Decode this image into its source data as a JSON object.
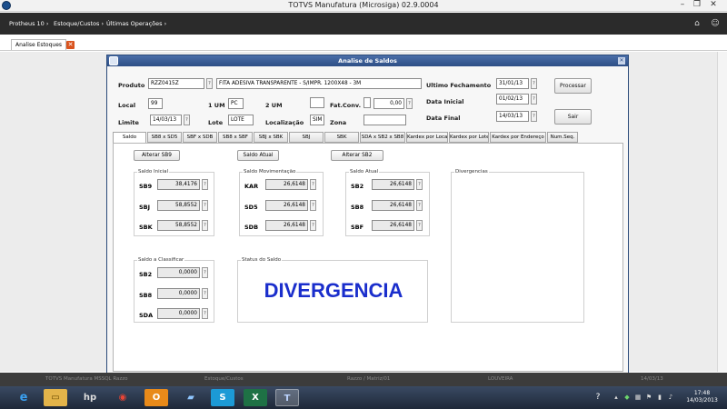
{
  "window": {
    "title": "TOTVS Manufatura (Microsiga) 02.9.0004"
  },
  "menubar": {
    "items": [
      "Protheus 10 ›",
      "Estoque/Custos ›",
      "Últimas Operações ›"
    ]
  },
  "doc_tab": {
    "label": "Analise Estoques"
  },
  "dialog": {
    "title": "Analise de Saldos",
    "produto": {
      "label": "Produto",
      "code": "RZZ0415Z",
      "description": "FITA ADESIVA TRANSPARENTE - S/IMPR. 1200X48 - 3M"
    },
    "local": {
      "label": "Local",
      "value": "99"
    },
    "um1": {
      "label": "1 UM",
      "value": "PC"
    },
    "um2": {
      "label": "2 UM",
      "value": ""
    },
    "fatconv": {
      "label": "Fat.Conv.",
      "flag": "",
      "value": "0,00"
    },
    "limite": {
      "label": "Limite",
      "value": "14/03/13"
    },
    "lote": {
      "label": "Lote",
      "value": "LOTE"
    },
    "localizacao": {
      "label": "Localização",
      "value": "SIM"
    },
    "zona": {
      "label": "Zona",
      "value": ""
    },
    "ultimo_fechamento": {
      "label": "Ultimo Fechamento",
      "value": "31/01/13"
    },
    "data_inicial": {
      "label": "Data Inicial",
      "value": "01/02/13"
    },
    "data_final": {
      "label": "Data Final",
      "value": "14/03/13"
    },
    "processar_label": "Processar",
    "sair_label": "Sair",
    "lookup_glyph": "?",
    "tabs": [
      "Saldo",
      "SB8 x SD5",
      "SBF x SDB",
      "SB8 x SBF",
      "SBJ x SBK",
      "SBJ",
      "SBK",
      "SDA x SB2 x SB8",
      "Kardex por Local",
      "Kardex por Lote",
      "Kardex por Endereço",
      "Num.Seq."
    ],
    "alterar_sb9_label": "Alterar SB9",
    "saldo_atual_label": "Saldo Atual",
    "alterar_sb2_label": "Alterar SB2",
    "saldo_inicial": {
      "title": "Saldo Inicial",
      "rows": [
        {
          "label": "SB9",
          "value": "38,4176"
        },
        {
          "label": "SBJ",
          "value": "58,8552"
        },
        {
          "label": "SBK",
          "value": "58,8552"
        }
      ]
    },
    "saldo_movimentacao": {
      "title": "Saldo Movimentação",
      "rows": [
        {
          "label": "KAR",
          "value": "26,6148"
        },
        {
          "label": "SD5",
          "value": "26,6148"
        },
        {
          "label": "SDB",
          "value": "26,6148"
        }
      ]
    },
    "saldo_atual": {
      "title": "Saldo Atual",
      "rows": [
        {
          "label": "SB2",
          "value": "26,6148"
        },
        {
          "label": "SB8",
          "value": "26,6148"
        },
        {
          "label": "SBF",
          "value": "26,6148"
        }
      ]
    },
    "saldo_classificar": {
      "title": "Saldo a Classificar",
      "rows": [
        {
          "label": "SB2",
          "value": "0,0000"
        },
        {
          "label": "SB8",
          "value": "0,0000"
        },
        {
          "label": "SDA",
          "value": "0,0000"
        }
      ]
    },
    "divergencias": {
      "title": "Divergencias"
    },
    "status_saldo": {
      "title": "Status do Saldo",
      "value": "DIVERGENCIA"
    }
  },
  "statusbar": {
    "items": [
      "TOTVS Manufatura MSSQL Razzo",
      "Estoque/Custos",
      "Razzo / Matriz/01",
      "LOUVEIRA",
      "14/03/13"
    ]
  },
  "taskbar": {
    "clock_time": "17:48",
    "clock_date": "14/03/2013"
  }
}
